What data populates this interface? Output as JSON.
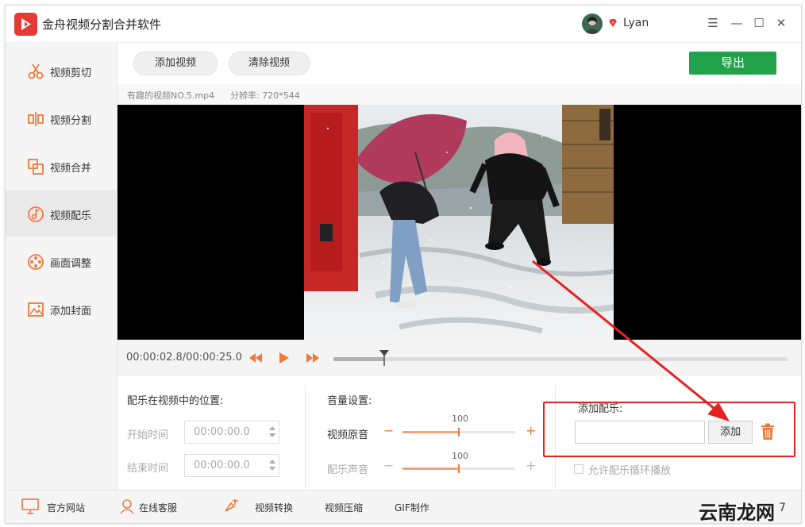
{
  "app": {
    "title": "金舟视频分割合并软件"
  },
  "user": {
    "name": "Lyan"
  },
  "window_controls": {
    "menu": "☰",
    "minimize": "—",
    "maximize": "☐",
    "close": "✕"
  },
  "sidebar": {
    "items": [
      {
        "label": "视频剪切",
        "icon": "scissors-icon"
      },
      {
        "label": "视频分割",
        "icon": "split-icon"
      },
      {
        "label": "视频合并",
        "icon": "merge-icon"
      },
      {
        "label": "视频配乐",
        "icon": "music-icon",
        "active": true
      },
      {
        "label": "画面调整",
        "icon": "film-reel-icon"
      },
      {
        "label": "添加封面",
        "icon": "image-icon"
      }
    ]
  },
  "toolbar": {
    "add_video": "添加视频",
    "clear_video": "清除视频",
    "export": "导出"
  },
  "file": {
    "name": "有趣的视频NO.5.mp4",
    "resolution_label": "分辨率: 720*544"
  },
  "playback": {
    "timecode": "00:00:02.8/00:00:25.0",
    "progress": 0.112
  },
  "position": {
    "title": "配乐在视频中的位置:",
    "start_label": "开始时间",
    "start_value": "00:00:00.0",
    "end_label": "结束时间",
    "end_value": "00:00:00.0"
  },
  "volume": {
    "title": "音量设置:",
    "original_label": "视频原音",
    "original_value": "100",
    "original_level": 0.5,
    "music_label": "配乐声音",
    "music_value": "100",
    "music_level": 0.5,
    "minus": "−",
    "plus": "+"
  },
  "music": {
    "title": "添加配乐:",
    "input_value": "",
    "add_button": "添加",
    "loop_label": "允许配乐循环播放"
  },
  "footer": {
    "items": [
      "官方网站",
      "在线客服",
      "视频转换",
      "视频压缩",
      "GIF制作"
    ],
    "watermark": "云南龙网",
    "suffix": "7"
  },
  "colors": {
    "accent": "#f07a3c",
    "export_green": "#22a24a",
    "annotation_red": "#e52222"
  }
}
